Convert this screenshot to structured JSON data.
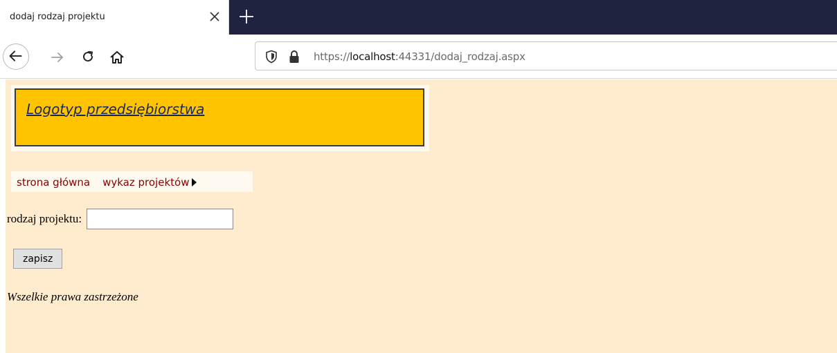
{
  "browser": {
    "tab_title": "dodaj rodzaj projektu",
    "url_prefix": "https://",
    "url_host": "localhost",
    "url_rest": ":44331/dodaj_rodzaj.aspx"
  },
  "page": {
    "logo_text": "Logotyp przedsiębiorstwa",
    "menu": [
      {
        "label": "strona główna"
      },
      {
        "label": "wykaz projektów"
      }
    ],
    "form": {
      "label": "rodzaj projektu:",
      "value": "",
      "save_label": "zapisz"
    },
    "footer": "Wszelkie prawa zastrzeżone"
  },
  "colors": {
    "tabstrip": "#1f2340",
    "page_bg": "#ffebcd",
    "logo_bg": "#ffc300",
    "menu_text": "#8b0000"
  }
}
